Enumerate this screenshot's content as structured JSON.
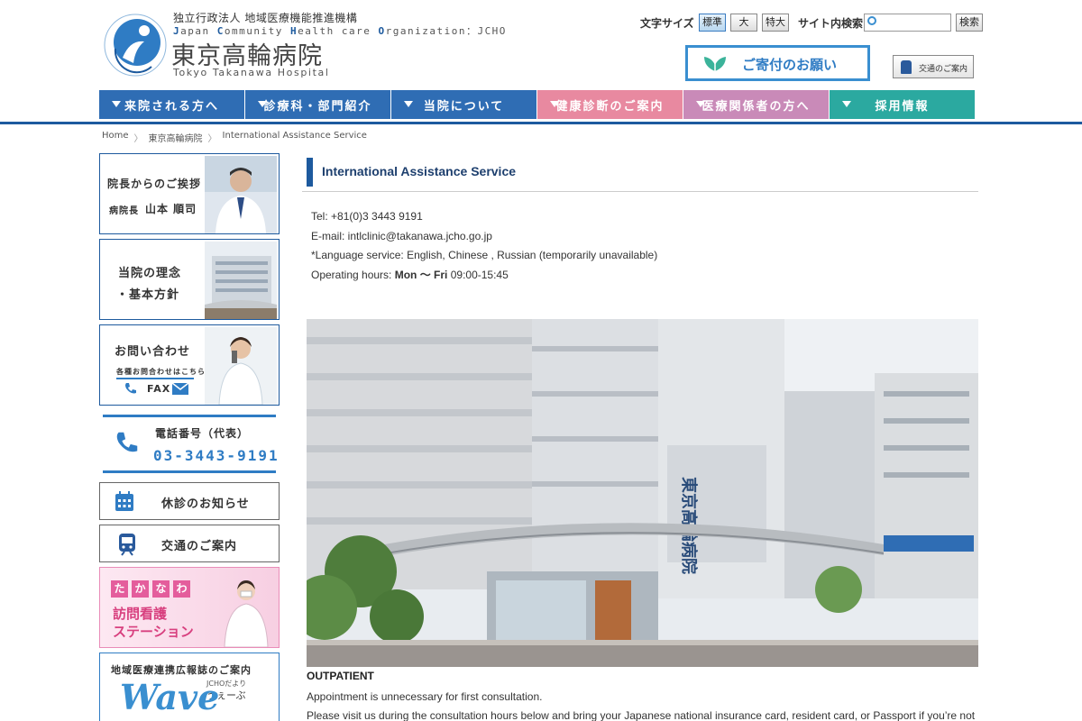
{
  "header": {
    "org_small": "独立行政法人 地域医療機能推進機構",
    "org_en_parts": [
      "J",
      "apan ",
      "C",
      "ommunity ",
      "H",
      "ealth care ",
      "O",
      "rganization：JCHO"
    ],
    "hospital_ja": "東京高輪病院",
    "hospital_en": "Tokyo Takanawa Hospital",
    "font_size_label": "文字サイズ",
    "font_sizes": [
      "標準",
      "大",
      "特大"
    ],
    "search_label": "サイト内検索",
    "search_button": "検索",
    "search_value": "",
    "donate_label": "ご寄付のお願い",
    "access_label": "交通のご案内"
  },
  "nav": {
    "items": [
      {
        "label": "来院される方へ",
        "color": "#2f6db4"
      },
      {
        "label": "診療科・部門紹介",
        "color": "#2f6db4"
      },
      {
        "label": "当院について",
        "color": "#2f6db4"
      },
      {
        "label": "健康診断のご案内",
        "color": "#e889a0"
      },
      {
        "label": "医療関係者の方へ",
        "color": "#c98ab8"
      },
      {
        "label": "採用情報",
        "color": "#2ba9a0"
      }
    ]
  },
  "breadcrumb": [
    "Home",
    "東京高輪病院",
    "International Assistance Service"
  ],
  "sidebar": {
    "greeting_title": "院長からのご挨拶",
    "greeting_role": "病院長",
    "greeting_name": "山本 順司",
    "philosophy_line1": "当院の理念",
    "philosophy_line2": "・基本方針",
    "inquiry_title": "お問い合わせ",
    "inquiry_sub": "各種お問合わせはこちら",
    "inquiry_fax": "FAX",
    "phone_title": "電話番号（代表）",
    "phone_number": "03-3443-9191",
    "closure_label": "休診のお知らせ",
    "access_label": "交通のご案内",
    "nursing_chars": [
      "た",
      "か",
      "な",
      "わ"
    ],
    "nursing_line1": "訪問看護",
    "nursing_line2": "ステーション",
    "wave_title": "地域医療連携広報誌のご案内",
    "wave_sub1": "JCHOだより",
    "wave_sub2": "うぇーぶ",
    "wave_logo": "Wave"
  },
  "main": {
    "heading": "International Assistance Service",
    "tel": "Tel: +81(0)3 3443 9191",
    "email": "E-mail: intlclinic@takanawa.jcho.go.jp",
    "language": "*Language service: English, Chinese , Russian (temporarily unavailable)",
    "hours_prefix": "Operating hours: ",
    "hours_days": "Mon 〜 Fri",
    "hours_time": " 09:00-15:45",
    "photo_sign": "東京高輪病院",
    "outpatient_heading": "OUTPATIENT",
    "outpatient_p1": "Appointment is unnecessary for first consultation.",
    "outpatient_p2": "Please visit us during the consultation hours below and bring your Japanese national insurance card, resident card, or Passport if you’re not"
  }
}
